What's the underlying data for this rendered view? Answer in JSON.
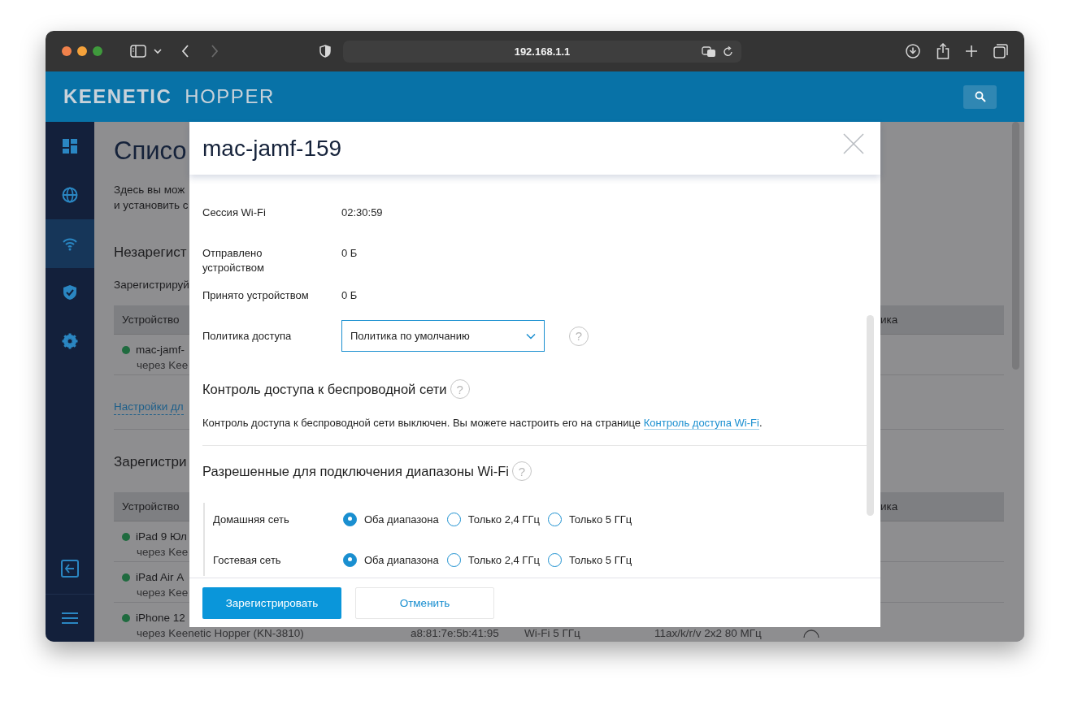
{
  "browser": {
    "address": "192.168.1.1"
  },
  "app_header": {
    "brand": "KEENETIC",
    "product": "HOPPER"
  },
  "sidebar": {
    "items": [
      {
        "selected": false
      },
      {
        "selected": false
      },
      {
        "selected": true
      },
      {
        "selected": false
      },
      {
        "selected": false
      }
    ]
  },
  "page": {
    "title": "Списо",
    "intro_lines": [
      "Здесь вы мож",
      "и установить с"
    ],
    "unregistered": {
      "heading": "Незарегист",
      "hint": "Зарегистрируй",
      "column_1": "Устройство",
      "column_3": "ика",
      "rows": [
        {
          "name": "mac-jamf-",
          "via": "через Kee"
        }
      ]
    },
    "settings_link": "Настройки дл",
    "registered": {
      "heading": "Зарегистри",
      "column_1": "Устройство",
      "column_3": "ика",
      "rows": [
        {
          "name": "iPad 9 Юл",
          "via": "через Kee"
        },
        {
          "name": "iPad Air А",
          "via": "через Kee"
        },
        {
          "name": "iPhone 12",
          "via": "через Keenetic Hopper (KN-3810)",
          "mac": "a8:81:7e:5b:41:95",
          "band": "Wi-Fi 5 ГГц",
          "mode": "11ax/k/r/v 2x2 80 МГц"
        }
      ]
    }
  },
  "dialog": {
    "title": "mac-jamf-159",
    "details": [
      {
        "label": "Сессия Wi-Fi",
        "value": "02:30:59"
      },
      {
        "label": "Отправлено устройством",
        "value": "0 Б"
      },
      {
        "label": "Принято устройством",
        "value": "0 Б"
      }
    ],
    "policy": {
      "label": "Политика доступа",
      "value": "Политика по умолчанию",
      "help": "?"
    },
    "wifi_access": {
      "heading": "Контроль доступа к беспроводной сети",
      "help": "?",
      "text": "Контроль доступа к беспроводной сети выключен. Вы можете настроить его на странице ",
      "link": "Контроль доступа Wi-Fi",
      "text_end": "."
    },
    "bands": {
      "heading": "Разрешенные для подключения диапазоны Wi-Fi",
      "help": "?",
      "rows": [
        {
          "label": "Домашняя сеть",
          "options": [
            {
              "label": "Оба диапазона",
              "selected": true
            },
            {
              "label": "Только 2,4 ГГц",
              "selected": false
            },
            {
              "label": "Только 5 ГГц",
              "selected": false
            }
          ]
        },
        {
          "label": "Гостевая сеть",
          "options": [
            {
              "label": "Оба диапазона",
              "selected": true
            },
            {
              "label": "Только 2,4 ГГц",
              "selected": false
            },
            {
              "label": "Только 5 ГГц",
              "selected": false
            }
          ]
        }
      ]
    },
    "buttons": [
      {
        "kind": "primary",
        "label": "Зарегистрировать"
      },
      {
        "kind": "secondary",
        "label": "Отменить"
      }
    ]
  }
}
